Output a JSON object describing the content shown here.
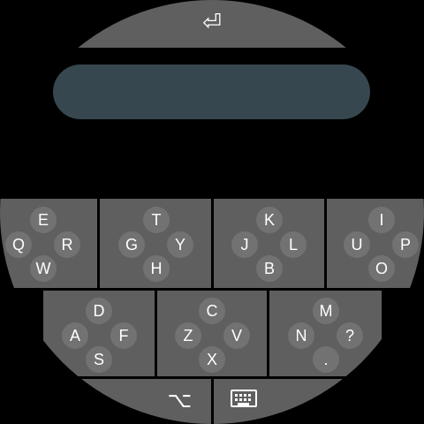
{
  "enter_key": {
    "glyph": "⏎"
  },
  "input": {
    "value": ""
  },
  "keyboard": {
    "row1": [
      {
        "keys": {
          "top": "E",
          "left": "Q",
          "right": "R",
          "bottom": "W"
        }
      },
      {
        "keys": {
          "top": "T",
          "left": "G",
          "right": "Y",
          "bottom": "H"
        }
      },
      {
        "keys": {
          "top": "K",
          "left": "J",
          "right": "L",
          "bottom": "B"
        }
      },
      {
        "keys": {
          "top": "I",
          "left": "U",
          "right": "P",
          "bottom": "O"
        }
      }
    ],
    "row2": [
      {
        "keys": {
          "top": "D",
          "left": "A",
          "right": "F",
          "bottom": "S"
        }
      },
      {
        "keys": {
          "top": "C",
          "left": "Z",
          "right": "V",
          "bottom": "X"
        }
      },
      {
        "keys": {
          "top": "M",
          "left": "N",
          "right": "?",
          "bottom": "."
        }
      }
    ]
  },
  "bottom_bar": {
    "symbols_glyph": "⌥"
  },
  "colors": {
    "key_panel": "#5f5f5f",
    "key_circle": "#727272",
    "input_pill": "#37474f",
    "background": "#000000"
  }
}
